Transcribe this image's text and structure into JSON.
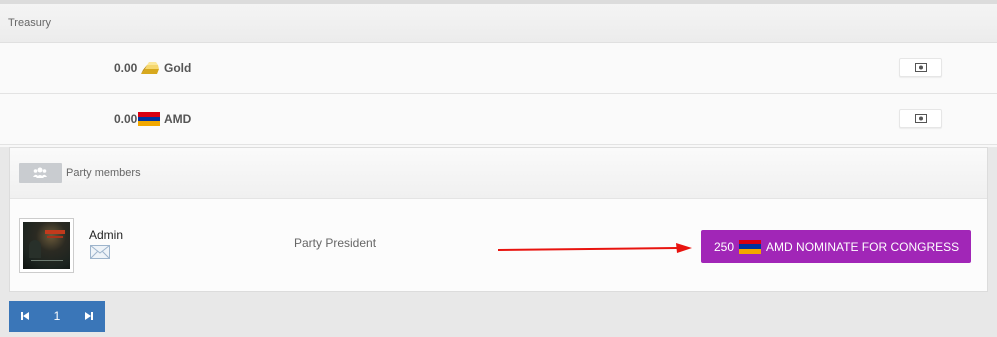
{
  "treasury": {
    "title": "Treasury",
    "rows": [
      {
        "amount": "0.00",
        "currency": "Gold",
        "icon": "gold-bar-icon"
      },
      {
        "amount": "0.00",
        "currency": "AMD",
        "icon": "armenia-flag-icon"
      }
    ],
    "exchange_icon": "money-icon"
  },
  "party": {
    "title": "Party members",
    "header_icon": "users-icon",
    "member": {
      "name": "Admin",
      "role": "Party President",
      "nominate_amount": "250",
      "nominate_label": "AMD NOMINATE FOR CONGRESS"
    }
  },
  "pagination": {
    "page": "1"
  },
  "colors": {
    "accent_purple": "#a126b7",
    "pager_blue": "#3a76b8",
    "arrow_red": "#e8140f"
  }
}
